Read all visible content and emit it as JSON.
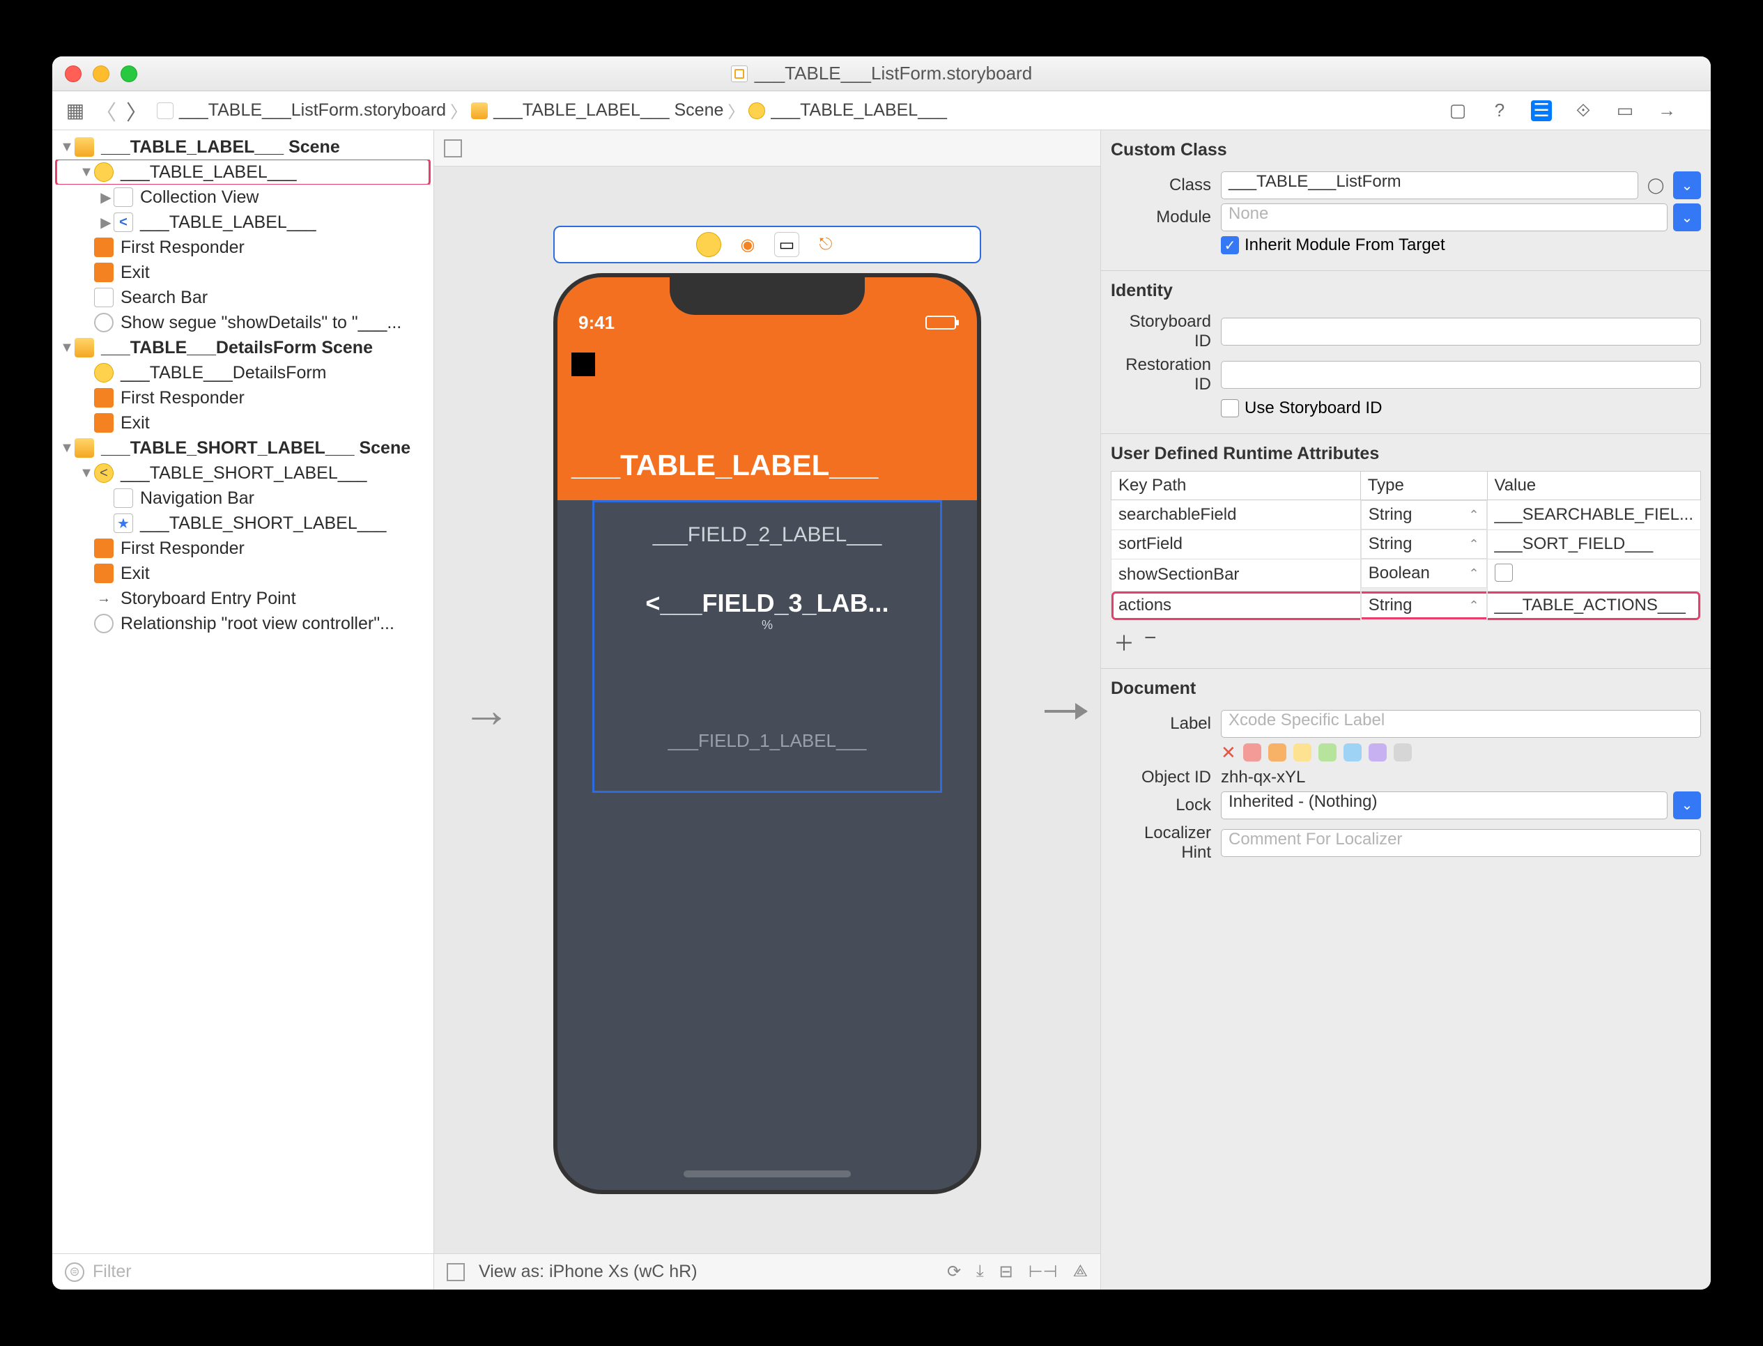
{
  "window": {
    "title": "___TABLE___ListForm.storyboard"
  },
  "breadcrumbs": [
    {
      "icon": "sb",
      "label": "___TABLE___ListForm.storyboard"
    },
    {
      "icon": "sc",
      "label": "___TABLE_LABEL___ Scene"
    },
    {
      "icon": "vc",
      "label": "___TABLE_LABEL___"
    }
  ],
  "outline": {
    "scenes": [
      {
        "label": "___TABLE_LABEL___ Scene",
        "items": [
          {
            "label": "___TABLE_LABEL___",
            "icon": "vc",
            "highlight": true,
            "disc": "open",
            "children": [
              {
                "label": "Collection View",
                "icon": "grid",
                "disc": "closed"
              },
              {
                "label": "___TABLE_LABEL___",
                "icon": "back",
                "disc": "closed"
              }
            ]
          },
          {
            "label": "First Responder",
            "icon": "cube"
          },
          {
            "label": "Exit",
            "icon": "exit"
          },
          {
            "label": "Search Bar",
            "icon": "bar"
          },
          {
            "label": "Show segue \"showDetails\" to \"___...",
            "icon": "segue"
          }
        ]
      },
      {
        "label": "___TABLE___DetailsForm Scene",
        "items": [
          {
            "label": "___TABLE___DetailsForm",
            "icon": "vc"
          },
          {
            "label": "First Responder",
            "icon": "cube"
          },
          {
            "label": "Exit",
            "icon": "exit"
          }
        ]
      },
      {
        "label": "___TABLE_SHORT_LABEL___ Scene",
        "items": [
          {
            "label": "___TABLE_SHORT_LABEL___",
            "icon": "nav",
            "disc": "open",
            "children": [
              {
                "label": "Navigation Bar",
                "icon": "navbar"
              },
              {
                "label": "___TABLE_SHORT_LABEL___",
                "icon": "star"
              }
            ]
          },
          {
            "label": "First Responder",
            "icon": "cube"
          },
          {
            "label": "Exit",
            "icon": "exit"
          },
          {
            "label": "Storyboard Entry Point",
            "icon": "arrow"
          },
          {
            "label": "Relationship \"root view controller\"...",
            "icon": "segue"
          }
        ]
      }
    ],
    "filter_placeholder": "Filter"
  },
  "canvas": {
    "status_time": "9:41",
    "header_title": "___TABLE_LABEL___",
    "field2": "___FIELD_2_LABEL___",
    "field3": "<___FIELD_3_LAB...",
    "field3_sub": "%",
    "field1": "___FIELD_1_LABEL___",
    "view_as": "View as: iPhone Xs (wC hR)"
  },
  "inspector": {
    "custom_class": {
      "title": "Custom Class",
      "class_label": "Class",
      "class_value": "___TABLE___ListForm",
      "module_label": "Module",
      "module_placeholder": "None",
      "inherit_label": "Inherit Module From Target",
      "inherit_checked": true
    },
    "identity": {
      "title": "Identity",
      "storyboard_id_label": "Storyboard ID",
      "restoration_id_label": "Restoration ID",
      "use_sb_id_label": "Use Storyboard ID"
    },
    "runtime": {
      "title": "User Defined Runtime Attributes",
      "cols": {
        "keypath": "Key Path",
        "type": "Type",
        "value": "Value"
      },
      "rows": [
        {
          "keypath": "searchableField",
          "type": "String",
          "value": "___SEARCHABLE_FIEL..."
        },
        {
          "keypath": "sortField",
          "type": "String",
          "value": "___SORT_FIELD___"
        },
        {
          "keypath": "showSectionBar",
          "type": "Boolean",
          "value": ""
        },
        {
          "keypath": "actions",
          "type": "String",
          "value": "___TABLE_ACTIONS___",
          "highlight": true
        }
      ]
    },
    "document": {
      "title": "Document",
      "label_label": "Label",
      "label_placeholder": "Xcode Specific Label",
      "object_id_label": "Object ID",
      "object_id": "zhh-qx-xYL",
      "lock_label": "Lock",
      "lock_value": "Inherited - (Nothing)",
      "localizer_label": "Localizer Hint",
      "localizer_placeholder": "Comment For Localizer",
      "swatches": [
        "#f39c97",
        "#f7b267",
        "#fde291",
        "#b6e49c",
        "#9fd3f5",
        "#c7b1f0",
        "#d6d6d6"
      ]
    }
  }
}
